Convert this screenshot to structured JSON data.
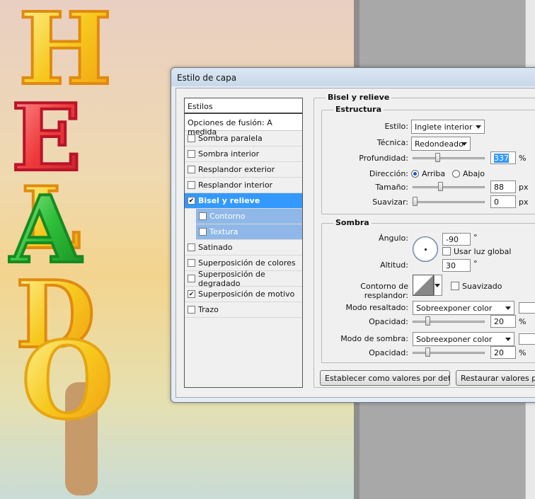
{
  "dialog": {
    "title": "Estilo de capa"
  },
  "styles_panel": {
    "header": "Estilos",
    "blend_options": "Opciones de fusión: A medida",
    "items": [
      {
        "label": "Sombra paralela",
        "checked": false
      },
      {
        "label": "Sombra interior",
        "checked": false
      },
      {
        "label": "Resplandor exterior",
        "checked": false
      },
      {
        "label": "Resplandor interior",
        "checked": false
      },
      {
        "label": "Bisel y relieve",
        "checked": true,
        "selected": true
      },
      {
        "label": "Contorno",
        "checked": false,
        "sub": true
      },
      {
        "label": "Textura",
        "checked": false,
        "sub": true
      },
      {
        "label": "Satinado",
        "checked": false
      },
      {
        "label": "Superposición de colores",
        "checked": false
      },
      {
        "label": "Superposición de degradado",
        "checked": false
      },
      {
        "label": "Superposición de motivo",
        "checked": true
      },
      {
        "label": "Trazo",
        "checked": false
      }
    ]
  },
  "bevel": {
    "title": "Bisel y relieve",
    "structure": {
      "title": "Estructura",
      "style_label": "Estilo:",
      "style_value": "Inglete interior",
      "technique_label": "Técnica:",
      "technique_value": "Redondeado",
      "depth_label": "Profundidad:",
      "depth_value": "337",
      "depth_unit": "%",
      "direction_label": "Dirección:",
      "direction_up": "Arriba",
      "direction_down": "Abajo",
      "size_label": "Tamaño:",
      "size_value": "88",
      "size_unit": "px",
      "soften_label": "Suavizar:",
      "soften_value": "0",
      "soften_unit": "px"
    },
    "shading": {
      "title": "Sombra",
      "angle_label": "Ángulo:",
      "angle_value": "-90",
      "angle_unit": "°",
      "global_light_label": "Usar luz global",
      "altitude_label": "Altitud:",
      "altitude_value": "30",
      "altitude_unit": "°",
      "gloss_contour_label": "Contorno de resplandor:",
      "antialiased_label": "Suavizado",
      "highlight_mode_label": "Modo resaltado:",
      "highlight_mode_value": "Sobreexponer color",
      "highlight_opacity_label": "Opacidad:",
      "highlight_opacity_value": "20",
      "highlight_opacity_unit": "%",
      "shadow_mode_label": "Modo de sombra:",
      "shadow_mode_value": "Sobreexponer color",
      "shadow_opacity_label": "Opacidad:",
      "shadow_opacity_value": "20",
      "shadow_opacity_unit": "%"
    },
    "buttons": {
      "make_default": "Establecer como valores por defecto",
      "reset_default": "Restaurar valores por d"
    }
  },
  "artwork": {
    "letters": [
      "H",
      "E",
      "L",
      "A",
      "D",
      "O"
    ],
    "colors": {
      "yellow": "#f5c518",
      "orange": "#f29a12",
      "red": "#ee3b3b",
      "green": "#2fbf3a",
      "stick": "#c79a6a"
    }
  }
}
